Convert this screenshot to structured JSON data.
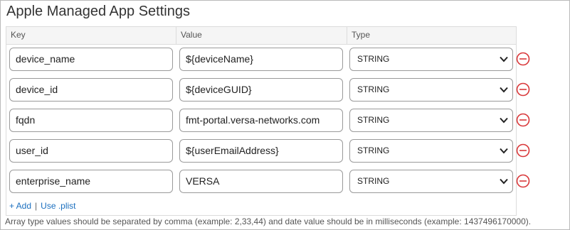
{
  "title": "Apple Managed App Settings",
  "columns": {
    "key": "Key",
    "value": "Value",
    "type": "Type"
  },
  "rows": [
    {
      "key": "device_name",
      "value": "${deviceName}",
      "type": "STRING"
    },
    {
      "key": "device_id",
      "value": "${deviceGUID}",
      "type": "STRING"
    },
    {
      "key": "fqdn",
      "value": "fmt-portal.versa-networks.com",
      "type": "STRING"
    },
    {
      "key": "user_id",
      "value": "${userEmailAddress}",
      "type": "STRING"
    },
    {
      "key": "enterprise_name",
      "value": "VERSA",
      "type": "STRING"
    }
  ],
  "actions": {
    "add": "+ Add",
    "separator": "|",
    "use_plist": "Use .plist"
  },
  "note": "Array type values should be separated by comma (example: 2,33,44) and date value should be in milliseconds (example: 1437496170000).",
  "colors": {
    "remove_icon": "#d9383a",
    "link": "#1b6fbf"
  },
  "icons": {
    "remove": "remove-circle-icon",
    "dropdown": "chevron-down-icon"
  }
}
